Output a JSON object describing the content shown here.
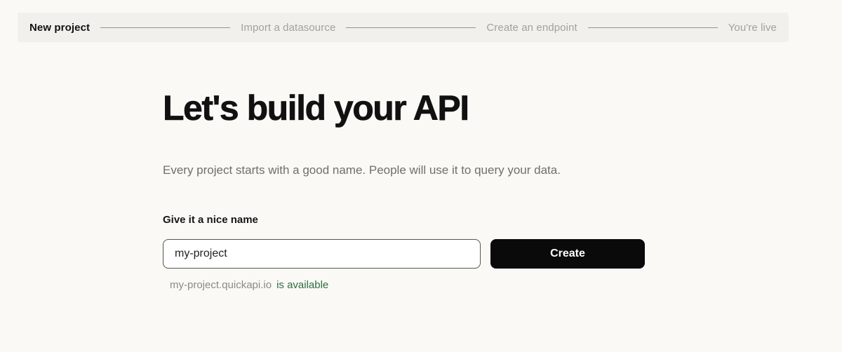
{
  "stepper": {
    "steps": [
      {
        "label": "New project",
        "state": "active"
      },
      {
        "label": "Import a datasource",
        "state": "upcoming"
      },
      {
        "label": "Create an endpoint",
        "state": "upcoming"
      },
      {
        "label": "You're live",
        "state": "upcoming"
      }
    ]
  },
  "main": {
    "title": "Let's build your API",
    "subtitle": "Every project starts with a good name. People will use it to query your data.",
    "form": {
      "name_label": "Give it a nice name",
      "input_value": "my-project",
      "create_button_label": "Create"
    },
    "availability": {
      "domain": "my-project.quickapi.io",
      "status": "is available"
    }
  },
  "colors": {
    "page_background": "#faf9f6",
    "stepper_background": "#f1f0ed",
    "active_step_text": "#121212",
    "inactive_step_text": "#a3a19c",
    "button_background": "#0a0a0a",
    "button_text": "#ffffff",
    "available_green": "#2e6e42",
    "muted_text": "#716f6b"
  }
}
